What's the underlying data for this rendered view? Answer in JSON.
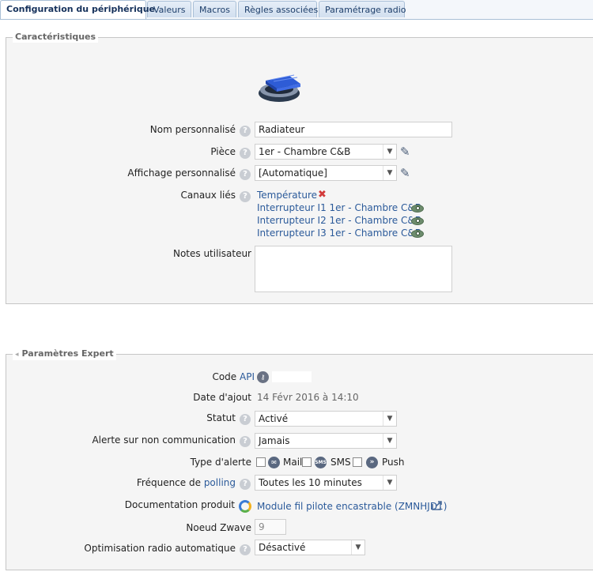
{
  "tabs": [
    {
      "label": "Configuration du périphérique",
      "active": true
    },
    {
      "label": "Valeurs",
      "active": false
    },
    {
      "label": "Macros",
      "active": false
    },
    {
      "label": "Règles associées",
      "active": false
    },
    {
      "label": "Paramétrage radio",
      "active": false
    }
  ],
  "caracteristiques": {
    "legend": "Caractéristiques",
    "nom_label": "Nom personnalisé",
    "nom_value": "Radiateur",
    "piece_label": "Pièce",
    "piece_value": "1er - Chambre C&B",
    "affichage_label": "Affichage personnalisé",
    "affichage_value": "[Automatique]",
    "canaux_label": "Canaux liés",
    "canaux": [
      "Température",
      "Interrupteur I1 1er - Chambre C&B",
      "Interrupteur I2 1er - Chambre C&B",
      "Interrupteur I3 1er - Chambre C&B"
    ],
    "notes_label": "Notes utilisateur"
  },
  "expert": {
    "legend": "Paramètres Expert",
    "code_label": "Code",
    "code_link": "API",
    "date_label": "Date d'ajout",
    "date_value": "14 Févr 2016 à 14:10",
    "statut_label": "Statut",
    "statut_value": "Activé",
    "alerte_label": "Alerte sur non communication",
    "alerte_value": "Jamais",
    "type_alerte_label": "Type d'alerte",
    "type_mail": "Mail",
    "type_sms": "SMS",
    "type_push": "Push",
    "sms_icon_text": "SMS",
    "frequence_label": "Fréquence de",
    "frequence_link": "polling",
    "frequence_value": "Toutes les 10 minutes",
    "doc_label": "Documentation produit",
    "doc_link": "Module fil pilote encastrable (ZMNHJD1)",
    "noeud_label": "Noeud Zwave",
    "noeud_value": "9",
    "optim_label": "Optimisation radio automatique",
    "optim_value": "Désactivé"
  },
  "icons": {
    "help": "?",
    "dropdown": "▼",
    "pencil": "✎",
    "unlink": "✖",
    "collapse": "◂"
  },
  "colors": {
    "tab_active_text": "#15315b",
    "link": "#2b5a9a",
    "fieldset_bg": "#f5f5f5",
    "help_icon": "#c9cdd3"
  }
}
